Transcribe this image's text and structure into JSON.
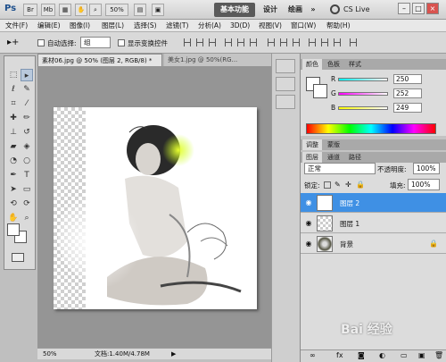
{
  "titlebar": {
    "logo": "Ps",
    "zoom": "50%",
    "workspaces": [
      "基本功能",
      "设计",
      "绘画"
    ],
    "more": "»",
    "cslive": "CS Live",
    "min": "–",
    "max": "□",
    "close": "×"
  },
  "menu": [
    "文件(F)",
    "编辑(E)",
    "图像(I)",
    "图层(L)",
    "选择(S)",
    "滤镜(T)",
    "分析(A)",
    "3D(D)",
    "视图(V)",
    "窗口(W)",
    "帮助(H)"
  ],
  "options": {
    "auto_select_label": "自动选择:",
    "auto_select_value": "组",
    "transform_label": "显示变换控件"
  },
  "doc_tabs": [
    {
      "label": "素材06.jpg @ 50% (图层 2, RGB/8) *"
    },
    {
      "label": "美女1.jpg @ 50%(RG..."
    }
  ],
  "status": {
    "zoom": "50%",
    "doc": "文档:1.40M/4.78M"
  },
  "color_panel": {
    "tabs": [
      "颜色",
      "色板",
      "样式"
    ],
    "r": 250,
    "g": 252,
    "b": 249,
    "r_label": "R",
    "g_label": "G",
    "b_label": "B"
  },
  "adjust_panel": {
    "tabs": [
      "调整",
      "蒙版"
    ]
  },
  "layers_panel": {
    "tabs": [
      "图层",
      "通道",
      "路径"
    ],
    "blend_mode": "正常",
    "opacity_label": "不透明度:",
    "opacity": "100%",
    "lock_label": "锁定:",
    "fill_label": "填充:",
    "fill": "100%",
    "layers": [
      {
        "name": "图层 2",
        "active": true
      },
      {
        "name": "图层 1",
        "active": false
      },
      {
        "name": "背景",
        "active": false
      }
    ]
  },
  "watermark": "Bai 经验"
}
